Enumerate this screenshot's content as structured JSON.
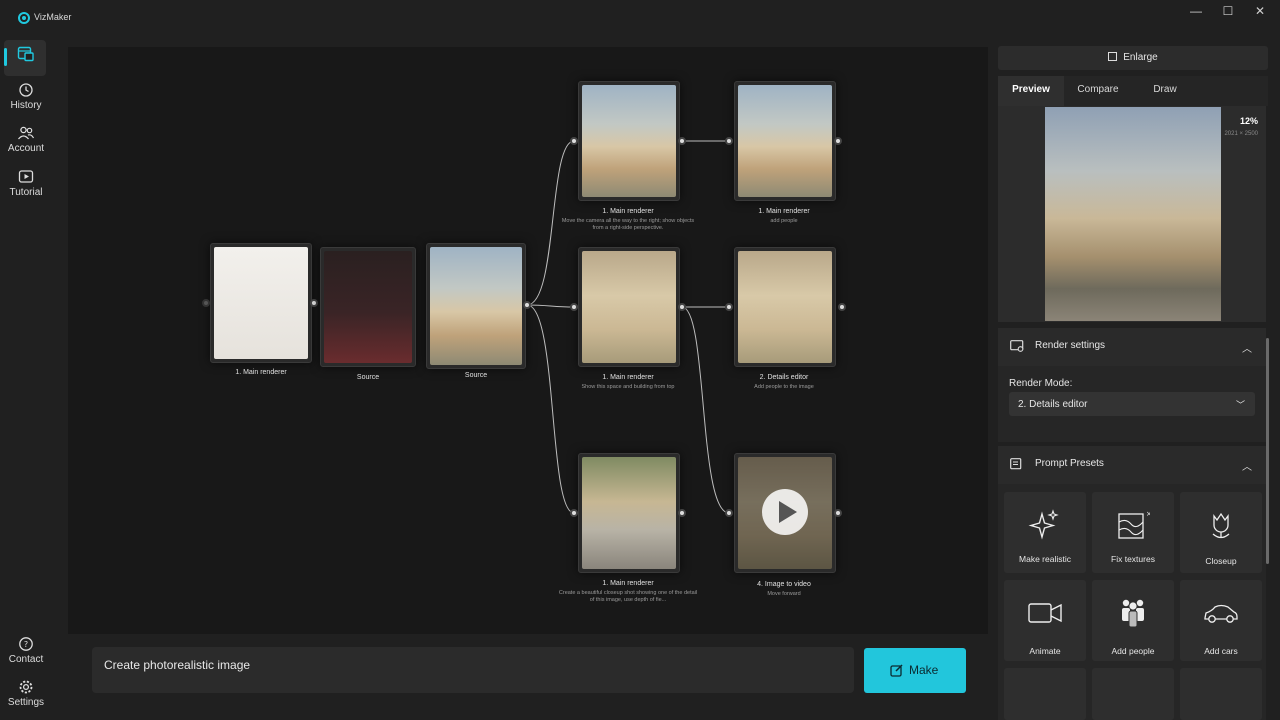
{
  "app": {
    "title": "VizMaker"
  },
  "window": {
    "minimize": "—",
    "maximize": "☐",
    "close": "✕"
  },
  "rail": {
    "items": [
      {
        "label": ""
      },
      {
        "label": "History"
      },
      {
        "label": "Account"
      },
      {
        "label": "Tutorial"
      },
      {
        "label": "Contact"
      },
      {
        "label": "Settings"
      }
    ]
  },
  "nodes": [
    {
      "label": "1. Main renderer",
      "sub": ""
    },
    {
      "label": "Source",
      "sub": ""
    },
    {
      "label": "Source",
      "sub": ""
    },
    {
      "label": "1. Main renderer",
      "sub": "Move the camera all the way to the right; show objects from a right-side perspective."
    },
    {
      "label": "1. Main renderer",
      "sub": "add people"
    },
    {
      "label": "1. Main renderer",
      "sub": "Show this space and building from top"
    },
    {
      "label": "2. Details editor",
      "sub": "Add people to the image"
    },
    {
      "label": "1. Main renderer",
      "sub": "Create a beautiful closeup shot showing one of the detail of this image, use depth of fie..."
    },
    {
      "label": "4. Image to video",
      "sub": "Move forward"
    }
  ],
  "prompt": {
    "text": "Create photorealistic image"
  },
  "make": {
    "label": "Make"
  },
  "right_panel": {
    "enlarge": "Enlarge",
    "tabs": [
      "Preview",
      "Compare",
      "Draw"
    ],
    "zoom": "12%",
    "dims": "2021 × 2500",
    "render_settings": {
      "title": "Render settings",
      "mode_label": "Render Mode:",
      "mode_value": "2. Details editor"
    },
    "prompt_presets": {
      "title": "Prompt Presets",
      "items": [
        "Make realistic",
        "Fix textures",
        "Closeup",
        "Animate",
        "Add people",
        "Add cars"
      ]
    }
  },
  "colors": {
    "accent": "#22c6dc",
    "bg": "#202020",
    "canvas": "#181818"
  }
}
